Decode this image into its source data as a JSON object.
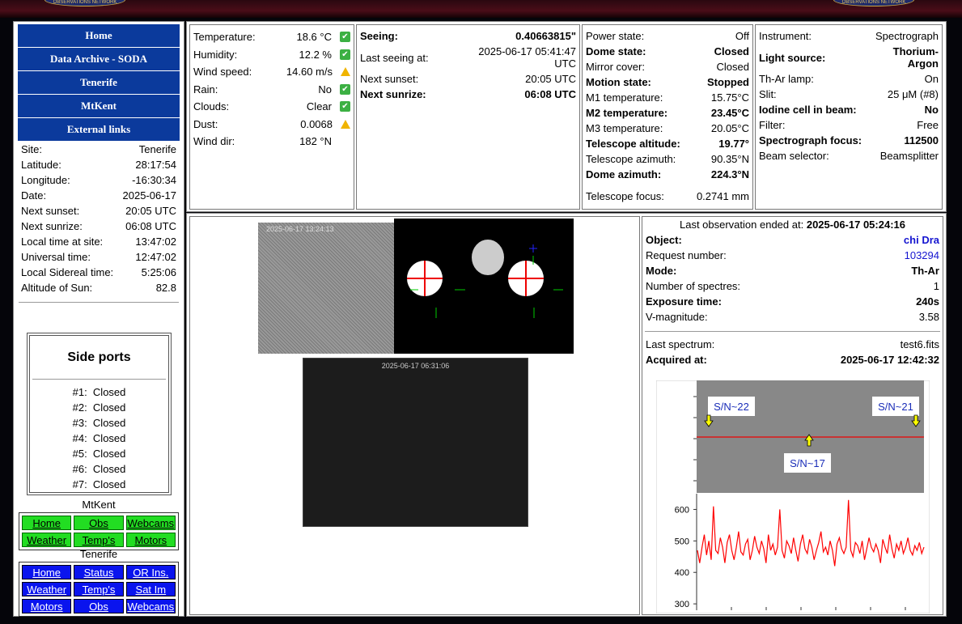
{
  "nav": [
    "Home",
    "Data Archive - SODA",
    "Tenerife",
    "MtKent",
    "External links"
  ],
  "site": [
    [
      "Site:",
      "Tenerife"
    ],
    [
      "Latitude:",
      "28:17:54"
    ],
    [
      "Longitude:",
      "-16:30:34"
    ],
    [
      "Date:",
      "2025-06-17"
    ],
    [
      "Next sunset:",
      "20:05 UTC"
    ],
    [
      "Next sunrize:",
      "06:08 UTC"
    ],
    [
      "Local time at site:",
      "13:47:02"
    ],
    [
      "Universal time:",
      "12:47:02"
    ],
    [
      "Local Sidereal time:",
      "5:25:06"
    ],
    [
      "Altitude of Sun:",
      "82.8"
    ]
  ],
  "side_ports": {
    "title": "Side ports",
    "ports": [
      [
        "#1:",
        "Closed"
      ],
      [
        "#2:",
        "Closed"
      ],
      [
        "#3:",
        "Closed"
      ],
      [
        "#4:",
        "Closed"
      ],
      [
        "#5:",
        "Closed"
      ],
      [
        "#6:",
        "Closed"
      ],
      [
        "#7:",
        "Closed"
      ]
    ]
  },
  "mtkent": {
    "title": "MtKent",
    "links": [
      "Home",
      "Obs",
      "Webcams",
      "Weather",
      "Temp's",
      "Motors"
    ]
  },
  "tenerife": {
    "title": "Tenerife",
    "links": [
      "Home",
      "Status",
      "OR Ins.",
      "Weather",
      "Temp's",
      "Sat Im",
      "Motors",
      "Obs",
      "Webcams"
    ]
  },
  "weather": [
    [
      "Temperature:",
      "18.6 °C",
      "ok"
    ],
    [
      "Humidity:",
      "12.2 %",
      "ok"
    ],
    [
      "Wind speed:",
      "14.60 m/s",
      "warn"
    ],
    [
      "Rain:",
      "No",
      "ok"
    ],
    [
      "Clouds:",
      "Clear",
      "ok"
    ],
    [
      "Dust:",
      "0.0068",
      "warn"
    ],
    [
      "Wind dir:",
      "182 °N",
      ""
    ]
  ],
  "seeing": {
    "seeing_label": "Seeing:",
    "seeing": "0.40663815\"",
    "last_label": "Last seeing at:",
    "last": "2025-06-17 05:41:47 UTC",
    "sunset_label": "Next sunset:",
    "sunset": "20:05 UTC",
    "sunrise_label": "Next sunrize:",
    "sunrise": "06:08 UTC"
  },
  "telescope": [
    [
      "Power state:",
      "Off",
      false
    ],
    [
      "Dome state:",
      "Closed",
      true
    ],
    [
      "Mirror cover:",
      "Closed",
      false
    ],
    [
      "Motion state:",
      "Stopped",
      true
    ],
    [
      "M1 temperature:",
      "15.75°C",
      false
    ],
    [
      "M2 temperature:",
      "23.45°C",
      true
    ],
    [
      "M3 temperature:",
      "20.05°C",
      false
    ],
    [
      "Telescope altitude:",
      "19.77°",
      true
    ],
    [
      "Telescope azimuth:",
      "90.35°N",
      false
    ],
    [
      "Dome azimuth:",
      "224.3°N",
      true
    ],
    [
      "Telescope focus:",
      "0.2741 mm",
      false
    ]
  ],
  "instrument": [
    [
      "Instrument:",
      "Spectrograph",
      false
    ],
    [
      "Light source:",
      "Thorium-Argon",
      true
    ],
    [
      "Th-Ar lamp:",
      "On",
      false
    ],
    [
      "Slit:",
      "25 μM (#8)",
      false
    ],
    [
      "Iodine cell in beam:",
      "No",
      true
    ],
    [
      "Filter:",
      "Free",
      false
    ],
    [
      "Spectrograph focus:",
      "112500",
      true
    ],
    [
      "Beam selector:",
      "Beamsplitter",
      false
    ]
  ],
  "camera": {
    "ts1": "2025-06-17 13:24:13",
    "ts2": "2025-06-17 06:31:06"
  },
  "observation": {
    "ended_label": "Last observation ended at:",
    "ended": "2025-06-17 05:24:16",
    "rows": [
      [
        "Object:",
        "chi Dra",
        true,
        true
      ],
      [
        "Request number:",
        "103294",
        false,
        true
      ],
      [
        "Mode:",
        "Th-Ar",
        true,
        false
      ],
      [
        "Number of spectres:",
        "1",
        false,
        false
      ],
      [
        "Exposure time:",
        "240s",
        true,
        false
      ],
      [
        "V-magnitude:",
        "3.58",
        false,
        false
      ]
    ],
    "spectrum_label": "Last spectrum:",
    "spectrum": "test6.fits",
    "acquired_label": "Acquired at:",
    "acquired": "2025-06-17 12:42:32"
  },
  "colors": {
    "nav_blue": "#0b3a9c",
    "link_green": "#22dd22",
    "link_blue": "#0a14ee",
    "spectrum": "#ff0000"
  },
  "chart_data": {
    "type": "line",
    "annotations": [
      "S/N~22",
      "S/N~21",
      "S/N~17"
    ],
    "yticks": [
      300,
      400,
      500,
      600
    ],
    "ylim": [
      290,
      650
    ],
    "series": [
      {
        "values": [
          470,
          430,
          480,
          520,
          455,
          500,
          440,
          610,
          470,
          460,
          510,
          480,
          430,
          495,
          520,
          470,
          440,
          480,
          530,
          465,
          455,
          490,
          505,
          440,
          470,
          515,
          480,
          460,
          500,
          475,
          430,
          520,
          470,
          490,
          455,
          480,
          600,
          470,
          445,
          500,
          485,
          460,
          510,
          470,
          435,
          490,
          520,
          475,
          460,
          505,
          480,
          440,
          470,
          495,
          530,
          465,
          480,
          455,
          500,
          470,
          420,
          490,
          510,
          475,
          460,
          480,
          630,
          470,
          450,
          495,
          485,
          460,
          500,
          440,
          475,
          510,
          480,
          465,
          490,
          470,
          430,
          505,
          480,
          460,
          520,
          475,
          445,
          490,
          470,
          500,
          460,
          480,
          510,
          470,
          455,
          485,
          470,
          495,
          460,
          480
        ]
      }
    ]
  }
}
